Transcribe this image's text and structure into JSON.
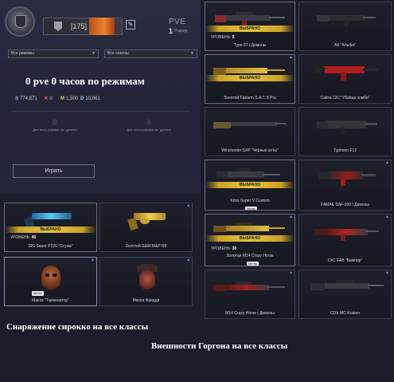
{
  "profile": {
    "rank_value": "[175]",
    "mode_label": "PVE",
    "rank_number": "1",
    "rank_word": "Разряд",
    "select_modes": "Все режимы",
    "select_seasons": "Все сезоны",
    "stats_heading": "0 pve 0 часов по режимам",
    "currencies": [
      {
        "symbol": "S",
        "value": "774,871"
      },
      {
        "symbol": "K",
        "value": "0"
      },
      {
        "symbol": "M",
        "value": "1,500"
      },
      {
        "symbol": "D",
        "value": "10,061"
      }
    ],
    "nodata_left": "Для этого режима нет данных",
    "nodata_right": "Для этого режима нет данных",
    "play_label": "Играть"
  },
  "chosen_label": "ВЫБРАНО",
  "level_label": "УРОВЕНЬ:",
  "skin_badge": "Меню",
  "right_column": [
    {
      "name": "Type 97 | Демоны",
      "selected": true,
      "level": "5"
    },
    {
      "name": "АК \"Альфа\"",
      "selected": false
    },
    {
      "name": "Золотой Fabarm S.A.T. 8 Pro",
      "selected": true
    },
    {
      "name": "Сайга-12С \"Убийца зомби\"",
      "selected": false
    },
    {
      "name": "Winchester SXP \"Черные коты\"",
      "selected": false
    },
    {
      "name": "Typhoon F12",
      "selected": false
    },
    {
      "name": "Kriss Super V Custom",
      "selected": true
    },
    {
      "name": "FAMAE SAF-200 | Демоны",
      "selected": false
    },
    {
      "name": "Золотая M14 Crazy Horse",
      "selected": true,
      "level": "30"
    },
    {
      "name": "СКС FAB \"Вампир\"",
      "selected": false
    },
    {
      "name": "M14 Crazy Horse | Демоны",
      "selected": false
    },
    {
      "name": "CDX-MC Kraken",
      "selected": false
    }
  ],
  "left_items": [
    {
      "name": "SIG Sauer P226 \"Стужа\"",
      "selected": true,
      "level": "45"
    },
    {
      "name": "Золотой S&W M&P R8",
      "selected": false
    },
    {
      "name": "Маска \"Тыквенатор\"",
      "selected": false
    },
    {
      "name": "Маска Фредди",
      "selected": false
    }
  ],
  "caption_left": "Снаряжение сирокко на все классы",
  "caption_right": "Внешности Горгона на все классы",
  "colors": {
    "background": "#1c1d2b",
    "gold": "#e6c440",
    "accent_blue": "#6aa6ff"
  }
}
